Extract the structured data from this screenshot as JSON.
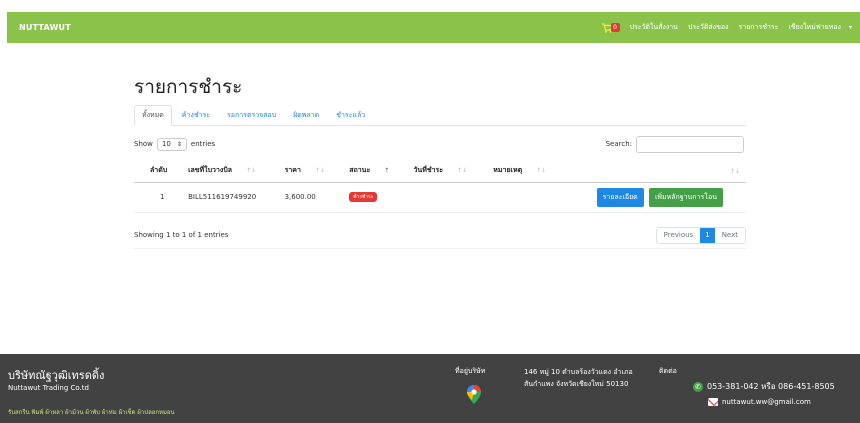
{
  "navbar": {
    "brand": "NUTTAWUT",
    "cart_count": "0",
    "links": [
      "ประวัติในสั่งงาน",
      "ประวัติส่งของ",
      "รายการชำระ",
      "เชียงใหม่ฟายทอง"
    ],
    "dropdown_caret": "▾",
    "color": "#8bc34a"
  },
  "page": {
    "title": "รายการชำระ",
    "tabs": [
      "ทั้งหมด",
      "ค้างชำระ",
      "รอการตรวจสอบ",
      "ผิดพลาด",
      "ชำระแล้ว"
    ],
    "active_tab": "ทั้งหมด"
  },
  "table_controls": {
    "show_label": "Show",
    "length_value": "10",
    "entries_label": "entries",
    "search_label": "Search:",
    "search_value": ""
  },
  "table": {
    "columns": [
      "ลำดับ",
      "เลขที่ใบวางบิล",
      "ราคา",
      "สถานะ",
      "วันที่ชำระ",
      "หมายเหตุ"
    ],
    "rows": [
      {
        "index": "1",
        "bill_no": "BILL511619749920",
        "price": "3,600.00",
        "status": "ค้างชำระ",
        "paid_date": "",
        "note": "",
        "actions": [
          "รายละเอียด",
          "เพิ่มหลักฐานการโอน"
        ]
      }
    ]
  },
  "pagination": {
    "info": "Showing 1 to 1 of 1 entries",
    "previous": "Previous",
    "current": "1",
    "next": "Next"
  },
  "footer": {
    "company_th": "บริษัทณัฐวุฒิเทรดดิ้ง",
    "company_en": "Nuttawut Trading Co.td",
    "services": "รับสกรีน พิมพ์ ผ้าหลา ผ้าม้วน ผ้าพับ ผ้าห่ม ผ้าเช็ด ผ้าปลอกหมอน",
    "address_title": "ที่อยู่บริษัท",
    "address_lines": [
      "146 หมู่ 10 ตำบลร้องวัวแดง อำเภอ",
      "สันกำแพง จังหวัดเชียงใหม่ 50130"
    ],
    "contact_title": "ติดต่อ",
    "phone": "053-381-042 หรือ 086-451-8505",
    "email": "nuttawut.ww@gmail.com",
    "background": "#424242"
  }
}
